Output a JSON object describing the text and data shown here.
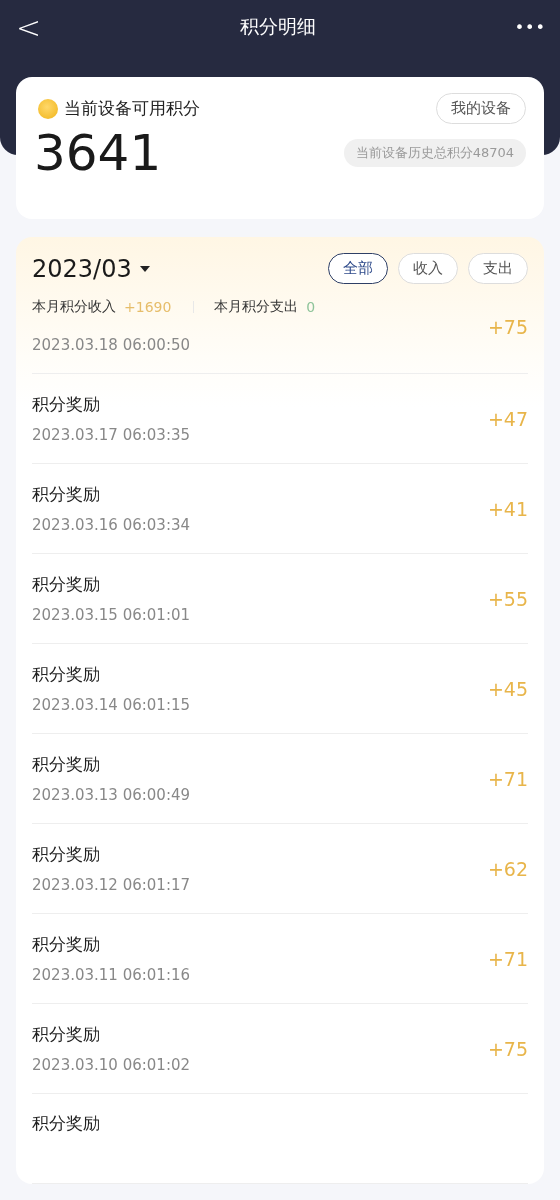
{
  "header": {
    "back": "<",
    "title": "积分明细",
    "more": "•••"
  },
  "balance": {
    "label": "当前设备可用积分",
    "button": "我的设备",
    "value": "3641",
    "history": "当前设备历史总积分48704"
  },
  "month": {
    "label": "2023/03",
    "filters": [
      {
        "label": "全部",
        "selected": true
      },
      {
        "label": "收入",
        "selected": false
      },
      {
        "label": "支出",
        "selected": false
      }
    ],
    "income_label": "本月积分收入",
    "income": "+1690",
    "expense_label": "本月积分支出",
    "expense": "0"
  },
  "records": [
    {
      "kind": "partial",
      "date": "2023.03.18 06:00:50",
      "amount": "+75"
    },
    {
      "kind": "full",
      "title": "积分奖励",
      "date": "2023.03.17 06:03:35",
      "amount": "+47"
    },
    {
      "kind": "full",
      "title": "积分奖励",
      "date": "2023.03.16 06:03:34",
      "amount": "+41"
    },
    {
      "kind": "full",
      "title": "积分奖励",
      "date": "2023.03.15 06:01:01",
      "amount": "+55"
    },
    {
      "kind": "full",
      "title": "积分奖励",
      "date": "2023.03.14 06:01:15",
      "amount": "+45"
    },
    {
      "kind": "full",
      "title": "积分奖励",
      "date": "2023.03.13 06:00:49",
      "amount": "+71"
    },
    {
      "kind": "full",
      "title": "积分奖励",
      "date": "2023.03.12 06:01:17",
      "amount": "+62"
    },
    {
      "kind": "full",
      "title": "积分奖励",
      "date": "2023.03.11 06:01:16",
      "amount": "+71"
    },
    {
      "kind": "full",
      "title": "积分奖励",
      "date": "2023.03.10 06:01:02",
      "amount": "+75"
    },
    {
      "kind": "title_only",
      "title": "积分奖励"
    }
  ]
}
